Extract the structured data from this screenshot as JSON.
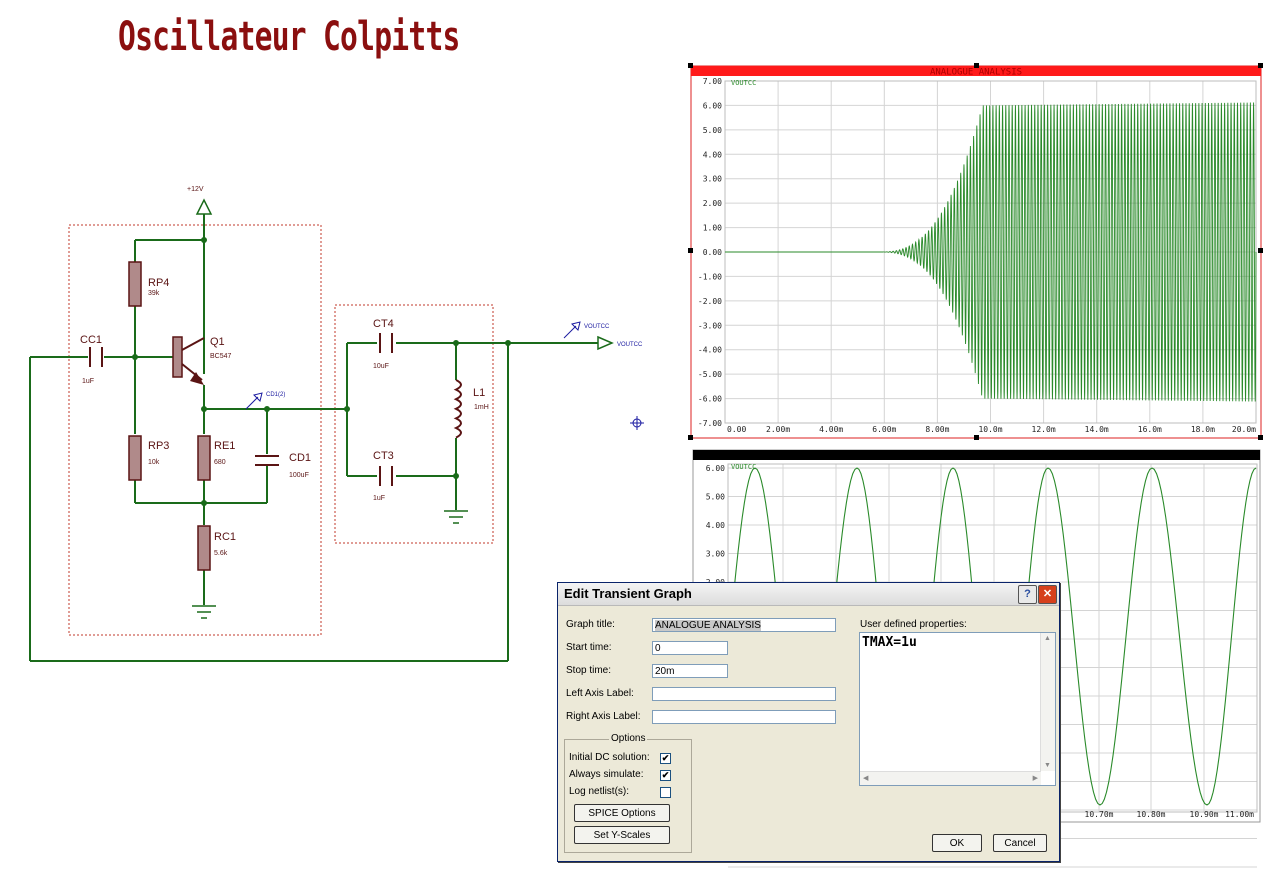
{
  "page_title": "Oscillateur Colpitts",
  "schematic": {
    "supply_label": "+12V",
    "components": [
      {
        "ref": "RP4",
        "value": "39k"
      },
      {
        "ref": "Q1",
        "value": "BC547"
      },
      {
        "ref": "CC1",
        "value": "1uF"
      },
      {
        "ref": "RP3",
        "value": "10k"
      },
      {
        "ref": "RE1",
        "value": "680"
      },
      {
        "ref": "CD1",
        "value": "100uF"
      },
      {
        "ref": "RC1",
        "value": "5.6k"
      },
      {
        "ref": "CT4",
        "value": "10uF"
      },
      {
        "ref": "L1",
        "value": "1mH"
      },
      {
        "ref": "CT3",
        "value": "1uF"
      }
    ],
    "probes": {
      "cd1": "CD1(2)",
      "voutcc": "VOUTCC"
    },
    "terminal_label": "VOUTCC"
  },
  "graph_top": {
    "title": "ANALOGUE ANALYSIS",
    "trace_label": "VOUTCC",
    "y_ticks": [
      "7.00",
      "6.00",
      "5.00",
      "4.00",
      "3.00",
      "2.00",
      "1.00",
      "0.00",
      "-1.00",
      "-2.00",
      "-3.00",
      "-4.00",
      "-5.00",
      "-6.00",
      "-7.00"
    ],
    "x_ticks": [
      "0.00",
      "2.00m",
      "4.00m",
      "6.00m",
      "8.00m",
      "10.0m",
      "12.0m",
      "14.0m",
      "16.0m",
      "18.0m",
      "20.0m"
    ]
  },
  "graph_bottom": {
    "trace_label": "VOUTCC",
    "y_ticks": [
      "6.00",
      "5.00",
      "4.00",
      "3.00",
      "2.00"
    ],
    "x_ticks": [
      "10.70m",
      "10.80m",
      "10.90m",
      "11.00m"
    ]
  },
  "chart_data": [
    {
      "type": "line",
      "title": "ANALOGUE ANALYSIS",
      "series": [
        {
          "name": "VOUTCC"
        }
      ],
      "xlim": [
        0,
        0.02
      ],
      "ylim": [
        -7,
        7
      ],
      "onset_s": 0.0058,
      "saturate_s": 0.0097,
      "amplitude_max": 6.0,
      "color": "#2a8a2a"
    },
    {
      "type": "line",
      "series": [
        {
          "name": "VOUTCC"
        }
      ],
      "ylim_visible": [
        2,
        6
      ],
      "peak": 6.0,
      "color": "#2a8a2a"
    }
  ],
  "dialog": {
    "title": "Edit Transient Graph",
    "help_glyph": "?",
    "close_glyph": "✕",
    "graph_title_label": "Graph title:",
    "graph_title_value": "ANALOGUE ANALYSIS",
    "start_time_label": "Start time:",
    "start_time_value": "0",
    "stop_time_label": "Stop time:",
    "stop_time_value": "20m",
    "left_axis_label": "Left Axis Label:",
    "left_axis_value": "",
    "right_axis_label": "Right Axis Label:",
    "right_axis_value": "",
    "options_label": "Options",
    "initial_dc_label": "Initial DC solution:",
    "initial_dc_checked": true,
    "always_simulate_label": "Always simulate:",
    "always_simulate_checked": true,
    "log_netlist_label": "Log netlist(s):",
    "log_netlist_checked": false,
    "spice_options_label": "SPICE Options",
    "set_y_scales_label": "Set Y-Scales",
    "user_props_label": "User defined properties:",
    "user_props_value": "TMAX=1u",
    "ok_label": "OK",
    "cancel_label": "Cancel",
    "check_glyph": "✔"
  }
}
